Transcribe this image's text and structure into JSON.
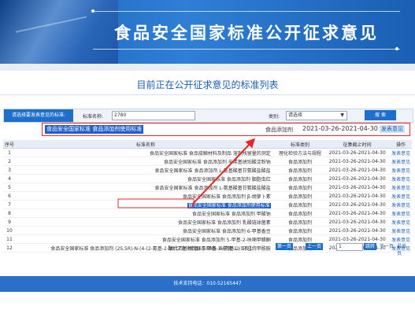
{
  "banner": {
    "title": "食品安全国家标准公开征求意见"
  },
  "subtitle": "目前正在公开征求意见的标准列表",
  "filter": {
    "label_button": "请选择要发表意见的标准:",
    "std_name_label": "标准名称:",
    "std_name_value": "2780",
    "category_label": "类别:",
    "category_value": "请选择",
    "search_button": "搜 索"
  },
  "highlight_row": {
    "name": "食品安全国家标准 食品添加剂使用标准",
    "category": "食品添加剂",
    "dates": "2021-03-26-2021-04-30",
    "action": "发表意见"
  },
  "table": {
    "headers": [
      "序号",
      "标准名称",
      "标准类别",
      "征集截止时间",
      "操作"
    ],
    "rows": [
      {
        "num": "1",
        "name": "食品安全国家标准 食品接触材料及制品 溶剂残留量的测定",
        "category": "理化检验方法与规程",
        "date": "2021-03-26-2021-04-30",
        "op": "发表意见"
      },
      {
        "num": "2",
        "name": "食品安全国家标准 食品添加剂 辛烯基琥珀酸淀粉钠",
        "category": "食品添加剂",
        "date": "2021-03-26-2021-04-30",
        "op": "发表意见"
      },
      {
        "num": "3",
        "name": "食品安全国家标准 食品添加剂 L-氨基酸基甘氨酸盐酸盐",
        "category": "食品添加剂",
        "date": "2021-03-26-2021-04-30",
        "op": "发表意见"
      },
      {
        "num": "4",
        "name": "食品安全国家标准 食品添加剂 胭脂虫红",
        "category": "食品添加剂",
        "date": "2021-03-26-2021-04-30",
        "op": "发表意见"
      },
      {
        "num": "5",
        "name": "食品安全国家标准 食品添加剂 L-氨基酸基甘氨酸盐酸盐",
        "category": "食品添加剂",
        "date": "2021-03-26-2021-04-30",
        "op": "发表意见"
      },
      {
        "num": "6",
        "name": "食品安全国家标准 食品添加剂 β-胡萝卜素",
        "category": "食品添加剂",
        "date": "2021-03-26-2021-04-30",
        "op": "发表意见"
      },
      {
        "num": "7",
        "name": "食品安全国家标准 食品添加剂使用标准",
        "category": "食品添加剂",
        "date": "2021-03-26-2021-04-30",
        "op": "发表意见",
        "highlight": true
      },
      {
        "num": "8",
        "name": "食品安全国家标准 食品添加剂 甲酸钠",
        "category": "食品添加剂",
        "date": "2021-03-26-2021-04-30",
        "op": "发表意见"
      },
      {
        "num": "9",
        "name": "食品安全国家标准 食品添加剂 乳酸链球菌素",
        "category": "食品添加剂",
        "date": "2021-03-26-2021-04-30",
        "op": "发表意见"
      },
      {
        "num": "10",
        "name": "食品安全国家标准 食品添加剂 6-甲基香豆",
        "category": "食品添加剂",
        "date": "2021-03-26-2021-04-30",
        "op": "发表意见"
      },
      {
        "num": "11",
        "name": "食品安全国家标准 食品添加剂 5-甲基-2-呋喃甲醛酮",
        "category": "食品添加剂",
        "date": "2021-03-26-2021-04-30",
        "op": "发表意见"
      },
      {
        "num": "12",
        "name": "食品安全国家标准 食品添加剂 (2S,5R)-N-(4-(2-氰基-2-氧代乙基)苯基)-5-甲基-2-(丙基-2-)环己烷甲酰胺",
        "category": "食品添加剂",
        "date": "2021-03-26-2021-04-30",
        "op": "发表意见"
      }
    ]
  },
  "pager": {
    "info": "【共12条 每页显示50条 当前第 1 / 1页】",
    "first": "第一页",
    "prev": "上一页",
    "page_value": "1",
    "goto": "跳转",
    "next": "下一页",
    "last": "最后页"
  },
  "footer": {
    "text": "技术支持电话：010-52165447"
  },
  "colors": {
    "accent": "#1d6fcb",
    "highlight_border": "#e32828"
  }
}
